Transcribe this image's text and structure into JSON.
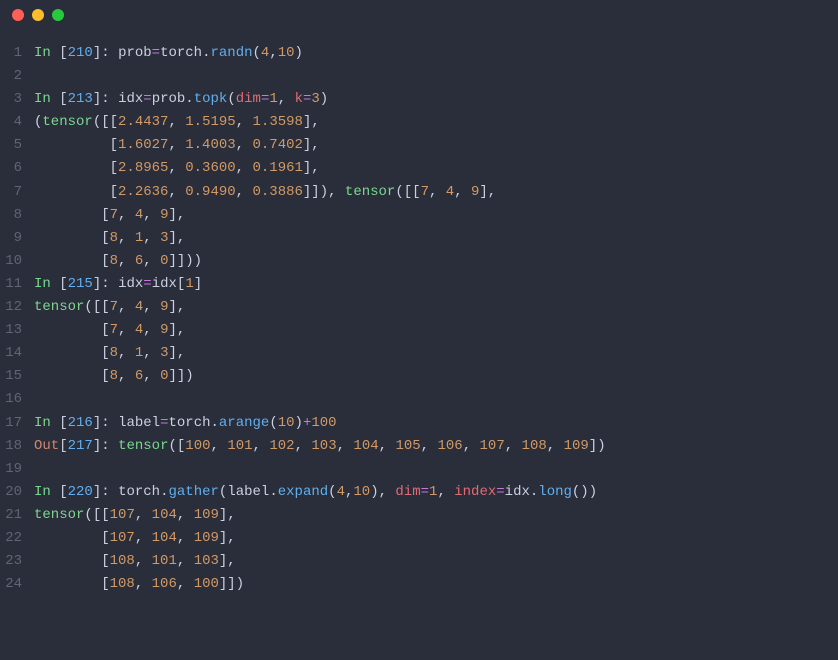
{
  "titlebar": {
    "dots": [
      "red",
      "yellow",
      "green"
    ]
  },
  "lines": [
    {
      "n": "1",
      "tokens": [
        {
          "t": "In ",
          "c": "tok-in"
        },
        {
          "t": "[",
          "c": "tok-paren"
        },
        {
          "t": "210",
          "c": "tok-bracknum"
        },
        {
          "t": "]",
          "c": "tok-paren"
        },
        {
          "t": ": ",
          "c": "tok-ident"
        },
        {
          "t": "prob",
          "c": "tok-ident"
        },
        {
          "t": "=",
          "c": "tok-op"
        },
        {
          "t": "torch",
          "c": "tok-ident"
        },
        {
          "t": ".",
          "c": "tok-dot"
        },
        {
          "t": "randn",
          "c": "tok-call"
        },
        {
          "t": "(",
          "c": "tok-paren"
        },
        {
          "t": "4",
          "c": "tok-num"
        },
        {
          "t": ",",
          "c": "tok-paren"
        },
        {
          "t": "10",
          "c": "tok-num"
        },
        {
          "t": ")",
          "c": "tok-paren"
        }
      ]
    },
    {
      "n": "2",
      "tokens": []
    },
    {
      "n": "3",
      "tokens": [
        {
          "t": "In ",
          "c": "tok-in"
        },
        {
          "t": "[",
          "c": "tok-paren"
        },
        {
          "t": "213",
          "c": "tok-bracknum"
        },
        {
          "t": "]",
          "c": "tok-paren"
        },
        {
          "t": ": ",
          "c": "tok-ident"
        },
        {
          "t": "idx",
          "c": "tok-ident"
        },
        {
          "t": "=",
          "c": "tok-op"
        },
        {
          "t": "prob",
          "c": "tok-ident"
        },
        {
          "t": ".",
          "c": "tok-dot"
        },
        {
          "t": "topk",
          "c": "tok-call"
        },
        {
          "t": "(",
          "c": "tok-paren"
        },
        {
          "t": "dim",
          "c": "tok-kw"
        },
        {
          "t": "=",
          "c": "tok-op"
        },
        {
          "t": "1",
          "c": "tok-num"
        },
        {
          "t": ", ",
          "c": "tok-paren"
        },
        {
          "t": "k",
          "c": "tok-kw"
        },
        {
          "t": "=",
          "c": "tok-op"
        },
        {
          "t": "3",
          "c": "tok-num"
        },
        {
          "t": ")",
          "c": "tok-paren"
        }
      ]
    },
    {
      "n": "4",
      "tokens": [
        {
          "t": "(",
          "c": "tok-paren"
        },
        {
          "t": "tensor",
          "c": "tok-in"
        },
        {
          "t": "([[",
          "c": "tok-paren"
        },
        {
          "t": "2.4437",
          "c": "tok-num"
        },
        {
          "t": ", ",
          "c": "tok-paren"
        },
        {
          "t": "1.5195",
          "c": "tok-num"
        },
        {
          "t": ", ",
          "c": "tok-paren"
        },
        {
          "t": "1.3598",
          "c": "tok-num"
        },
        {
          "t": "],",
          "c": "tok-paren"
        }
      ]
    },
    {
      "n": "5",
      "tokens": [
        {
          "t": "         [",
          "c": "tok-paren"
        },
        {
          "t": "1.6027",
          "c": "tok-num"
        },
        {
          "t": ", ",
          "c": "tok-paren"
        },
        {
          "t": "1.4003",
          "c": "tok-num"
        },
        {
          "t": ", ",
          "c": "tok-paren"
        },
        {
          "t": "0.7402",
          "c": "tok-num"
        },
        {
          "t": "],",
          "c": "tok-paren"
        }
      ]
    },
    {
      "n": "6",
      "tokens": [
        {
          "t": "         [",
          "c": "tok-paren"
        },
        {
          "t": "2.8965",
          "c": "tok-num"
        },
        {
          "t": ", ",
          "c": "tok-paren"
        },
        {
          "t": "0.3600",
          "c": "tok-num"
        },
        {
          "t": ", ",
          "c": "tok-paren"
        },
        {
          "t": "0.1961",
          "c": "tok-num"
        },
        {
          "t": "],",
          "c": "tok-paren"
        }
      ]
    },
    {
      "n": "7",
      "tokens": [
        {
          "t": "         [",
          "c": "tok-paren"
        },
        {
          "t": "2.2636",
          "c": "tok-num"
        },
        {
          "t": ", ",
          "c": "tok-paren"
        },
        {
          "t": "0.9490",
          "c": "tok-num"
        },
        {
          "t": ", ",
          "c": "tok-paren"
        },
        {
          "t": "0.3886",
          "c": "tok-num"
        },
        {
          "t": "]]), ",
          "c": "tok-paren"
        },
        {
          "t": "tensor",
          "c": "tok-in"
        },
        {
          "t": "([[",
          "c": "tok-paren"
        },
        {
          "t": "7",
          "c": "tok-num"
        },
        {
          "t": ", ",
          "c": "tok-paren"
        },
        {
          "t": "4",
          "c": "tok-num"
        },
        {
          "t": ", ",
          "c": "tok-paren"
        },
        {
          "t": "9",
          "c": "tok-num"
        },
        {
          "t": "],",
          "c": "tok-paren"
        }
      ]
    },
    {
      "n": "8",
      "tokens": [
        {
          "t": "        [",
          "c": "tok-paren"
        },
        {
          "t": "7",
          "c": "tok-num"
        },
        {
          "t": ", ",
          "c": "tok-paren"
        },
        {
          "t": "4",
          "c": "tok-num"
        },
        {
          "t": ", ",
          "c": "tok-paren"
        },
        {
          "t": "9",
          "c": "tok-num"
        },
        {
          "t": "],",
          "c": "tok-paren"
        }
      ]
    },
    {
      "n": "9",
      "tokens": [
        {
          "t": "        [",
          "c": "tok-paren"
        },
        {
          "t": "8",
          "c": "tok-num"
        },
        {
          "t": ", ",
          "c": "tok-paren"
        },
        {
          "t": "1",
          "c": "tok-num"
        },
        {
          "t": ", ",
          "c": "tok-paren"
        },
        {
          "t": "3",
          "c": "tok-num"
        },
        {
          "t": "],",
          "c": "tok-paren"
        }
      ]
    },
    {
      "n": "10",
      "tokens": [
        {
          "t": "        [",
          "c": "tok-paren"
        },
        {
          "t": "8",
          "c": "tok-num"
        },
        {
          "t": ", ",
          "c": "tok-paren"
        },
        {
          "t": "6",
          "c": "tok-num"
        },
        {
          "t": ", ",
          "c": "tok-paren"
        },
        {
          "t": "0",
          "c": "tok-num"
        },
        {
          "t": "]]))",
          "c": "tok-paren"
        }
      ]
    },
    {
      "n": "11",
      "tokens": [
        {
          "t": "In ",
          "c": "tok-in"
        },
        {
          "t": "[",
          "c": "tok-paren"
        },
        {
          "t": "215",
          "c": "tok-bracknum"
        },
        {
          "t": "]",
          "c": "tok-paren"
        },
        {
          "t": ": ",
          "c": "tok-ident"
        },
        {
          "t": "idx",
          "c": "tok-ident"
        },
        {
          "t": "=",
          "c": "tok-op"
        },
        {
          "t": "idx",
          "c": "tok-ident"
        },
        {
          "t": "[",
          "c": "tok-paren"
        },
        {
          "t": "1",
          "c": "tok-num"
        },
        {
          "t": "]",
          "c": "tok-paren"
        }
      ]
    },
    {
      "n": "12",
      "tokens": [
        {
          "t": "tensor",
          "c": "tok-in"
        },
        {
          "t": "([[",
          "c": "tok-paren"
        },
        {
          "t": "7",
          "c": "tok-num"
        },
        {
          "t": ", ",
          "c": "tok-paren"
        },
        {
          "t": "4",
          "c": "tok-num"
        },
        {
          "t": ", ",
          "c": "tok-paren"
        },
        {
          "t": "9",
          "c": "tok-num"
        },
        {
          "t": "],",
          "c": "tok-paren"
        }
      ]
    },
    {
      "n": "13",
      "tokens": [
        {
          "t": "        [",
          "c": "tok-paren"
        },
        {
          "t": "7",
          "c": "tok-num"
        },
        {
          "t": ", ",
          "c": "tok-paren"
        },
        {
          "t": "4",
          "c": "tok-num"
        },
        {
          "t": ", ",
          "c": "tok-paren"
        },
        {
          "t": "9",
          "c": "tok-num"
        },
        {
          "t": "],",
          "c": "tok-paren"
        }
      ]
    },
    {
      "n": "14",
      "tokens": [
        {
          "t": "        [",
          "c": "tok-paren"
        },
        {
          "t": "8",
          "c": "tok-num"
        },
        {
          "t": ", ",
          "c": "tok-paren"
        },
        {
          "t": "1",
          "c": "tok-num"
        },
        {
          "t": ", ",
          "c": "tok-paren"
        },
        {
          "t": "3",
          "c": "tok-num"
        },
        {
          "t": "],",
          "c": "tok-paren"
        }
      ]
    },
    {
      "n": "15",
      "tokens": [
        {
          "t": "        [",
          "c": "tok-paren"
        },
        {
          "t": "8",
          "c": "tok-num"
        },
        {
          "t": ", ",
          "c": "tok-paren"
        },
        {
          "t": "6",
          "c": "tok-num"
        },
        {
          "t": ", ",
          "c": "tok-paren"
        },
        {
          "t": "0",
          "c": "tok-num"
        },
        {
          "t": "]])",
          "c": "tok-paren"
        }
      ]
    },
    {
      "n": "16",
      "tokens": []
    },
    {
      "n": "17",
      "tokens": [
        {
          "t": "In ",
          "c": "tok-in"
        },
        {
          "t": "[",
          "c": "tok-paren"
        },
        {
          "t": "216",
          "c": "tok-bracknum"
        },
        {
          "t": "]",
          "c": "tok-paren"
        },
        {
          "t": ": ",
          "c": "tok-ident"
        },
        {
          "t": "label",
          "c": "tok-ident"
        },
        {
          "t": "=",
          "c": "tok-op"
        },
        {
          "t": "torch",
          "c": "tok-ident"
        },
        {
          "t": ".",
          "c": "tok-dot"
        },
        {
          "t": "arange",
          "c": "tok-call"
        },
        {
          "t": "(",
          "c": "tok-paren"
        },
        {
          "t": "10",
          "c": "tok-num"
        },
        {
          "t": ")",
          "c": "tok-paren"
        },
        {
          "t": "+",
          "c": "tok-op"
        },
        {
          "t": "100",
          "c": "tok-num"
        }
      ]
    },
    {
      "n": "18",
      "tokens": [
        {
          "t": "Out",
          "c": "tok-out"
        },
        {
          "t": "[",
          "c": "tok-paren"
        },
        {
          "t": "217",
          "c": "tok-bracknum"
        },
        {
          "t": "]",
          "c": "tok-paren"
        },
        {
          "t": ": ",
          "c": "tok-ident"
        },
        {
          "t": "tensor",
          "c": "tok-in"
        },
        {
          "t": "([",
          "c": "tok-paren"
        },
        {
          "t": "100",
          "c": "tok-num"
        },
        {
          "t": ", ",
          "c": "tok-paren"
        },
        {
          "t": "101",
          "c": "tok-num"
        },
        {
          "t": ", ",
          "c": "tok-paren"
        },
        {
          "t": "102",
          "c": "tok-num"
        },
        {
          "t": ", ",
          "c": "tok-paren"
        },
        {
          "t": "103",
          "c": "tok-num"
        },
        {
          "t": ", ",
          "c": "tok-paren"
        },
        {
          "t": "104",
          "c": "tok-num"
        },
        {
          "t": ", ",
          "c": "tok-paren"
        },
        {
          "t": "105",
          "c": "tok-num"
        },
        {
          "t": ", ",
          "c": "tok-paren"
        },
        {
          "t": "106",
          "c": "tok-num"
        },
        {
          "t": ", ",
          "c": "tok-paren"
        },
        {
          "t": "107",
          "c": "tok-num"
        },
        {
          "t": ", ",
          "c": "tok-paren"
        },
        {
          "t": "108",
          "c": "tok-num"
        },
        {
          "t": ", ",
          "c": "tok-paren"
        },
        {
          "t": "109",
          "c": "tok-num"
        },
        {
          "t": "])",
          "c": "tok-paren"
        }
      ]
    },
    {
      "n": "19",
      "tokens": []
    },
    {
      "n": "20",
      "tokens": [
        {
          "t": "In ",
          "c": "tok-in"
        },
        {
          "t": "[",
          "c": "tok-paren"
        },
        {
          "t": "220",
          "c": "tok-bracknum"
        },
        {
          "t": "]",
          "c": "tok-paren"
        },
        {
          "t": ": ",
          "c": "tok-ident"
        },
        {
          "t": "torch",
          "c": "tok-ident"
        },
        {
          "t": ".",
          "c": "tok-dot"
        },
        {
          "t": "gather",
          "c": "tok-call"
        },
        {
          "t": "(",
          "c": "tok-paren"
        },
        {
          "t": "label",
          "c": "tok-ident"
        },
        {
          "t": ".",
          "c": "tok-dot"
        },
        {
          "t": "expand",
          "c": "tok-call"
        },
        {
          "t": "(",
          "c": "tok-paren"
        },
        {
          "t": "4",
          "c": "tok-num"
        },
        {
          "t": ",",
          "c": "tok-paren"
        },
        {
          "t": "10",
          "c": "tok-num"
        },
        {
          "t": "), ",
          "c": "tok-paren"
        },
        {
          "t": "dim",
          "c": "tok-kw"
        },
        {
          "t": "=",
          "c": "tok-op"
        },
        {
          "t": "1",
          "c": "tok-num"
        },
        {
          "t": ", ",
          "c": "tok-paren"
        },
        {
          "t": "index",
          "c": "tok-kw"
        },
        {
          "t": "=",
          "c": "tok-op"
        },
        {
          "t": "idx",
          "c": "tok-ident"
        },
        {
          "t": ".",
          "c": "tok-dot"
        },
        {
          "t": "long",
          "c": "tok-call"
        },
        {
          "t": "())",
          "c": "tok-paren"
        }
      ]
    },
    {
      "n": "21",
      "tokens": [
        {
          "t": "tensor",
          "c": "tok-in"
        },
        {
          "t": "([[",
          "c": "tok-paren"
        },
        {
          "t": "107",
          "c": "tok-num"
        },
        {
          "t": ", ",
          "c": "tok-paren"
        },
        {
          "t": "104",
          "c": "tok-num"
        },
        {
          "t": ", ",
          "c": "tok-paren"
        },
        {
          "t": "109",
          "c": "tok-num"
        },
        {
          "t": "],",
          "c": "tok-paren"
        }
      ]
    },
    {
      "n": "22",
      "tokens": [
        {
          "t": "        [",
          "c": "tok-paren"
        },
        {
          "t": "107",
          "c": "tok-num"
        },
        {
          "t": ", ",
          "c": "tok-paren"
        },
        {
          "t": "104",
          "c": "tok-num"
        },
        {
          "t": ", ",
          "c": "tok-paren"
        },
        {
          "t": "109",
          "c": "tok-num"
        },
        {
          "t": "],",
          "c": "tok-paren"
        }
      ]
    },
    {
      "n": "23",
      "tokens": [
        {
          "t": "        [",
          "c": "tok-paren"
        },
        {
          "t": "108",
          "c": "tok-num"
        },
        {
          "t": ", ",
          "c": "tok-paren"
        },
        {
          "t": "101",
          "c": "tok-num"
        },
        {
          "t": ", ",
          "c": "tok-paren"
        },
        {
          "t": "103",
          "c": "tok-num"
        },
        {
          "t": "],",
          "c": "tok-paren"
        }
      ]
    },
    {
      "n": "24",
      "tokens": [
        {
          "t": "        [",
          "c": "tok-paren"
        },
        {
          "t": "108",
          "c": "tok-num"
        },
        {
          "t": ", ",
          "c": "tok-paren"
        },
        {
          "t": "106",
          "c": "tok-num"
        },
        {
          "t": ", ",
          "c": "tok-paren"
        },
        {
          "t": "100",
          "c": "tok-num"
        },
        {
          "t": "]])",
          "c": "tok-paren"
        }
      ]
    }
  ]
}
